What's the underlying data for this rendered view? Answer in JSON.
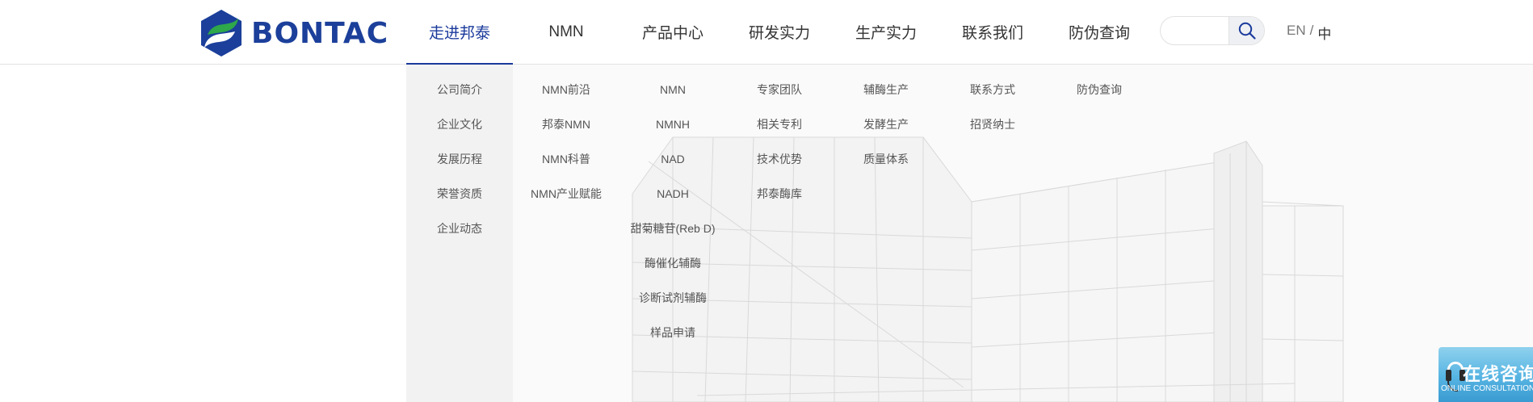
{
  "brand": {
    "name": "BONTAC"
  },
  "nav": [
    {
      "label": "走进邦泰",
      "active": true
    },
    {
      "label": "NMN",
      "active": false
    },
    {
      "label": "产品中心",
      "active": false
    },
    {
      "label": "研发实力",
      "active": false
    },
    {
      "label": "生产实力",
      "active": false
    },
    {
      "label": "联系我们",
      "active": false
    },
    {
      "label": "防伪查询",
      "active": false
    }
  ],
  "search": {
    "placeholder": "",
    "value": ""
  },
  "lang": {
    "en": "EN",
    "sep": "/",
    "zh": "中"
  },
  "dropdown": {
    "columns": [
      [
        "公司简介",
        "企业文化",
        "发展历程",
        "荣誉资质",
        "企业动态"
      ],
      [
        "NMN前沿",
        "邦泰NMN",
        "NMN科普",
        "NMN产业赋能"
      ],
      [
        "NMN",
        "NMNH",
        "NAD",
        "NADH",
        "甜菊糖苷(Reb D)",
        "酶催化辅酶",
        "诊断试剂辅酶",
        "样品申请"
      ],
      [
        "专家团队",
        "相关专利",
        "技术优势",
        "邦泰酶库"
      ],
      [
        "辅酶生产",
        "发酵生产",
        "质量体系"
      ],
      [
        "联系方式",
        "招贤纳士"
      ],
      [
        "防伪查询"
      ]
    ]
  },
  "consult": {
    "title": "在线咨询",
    "subtitle": "ONLINE CONSULTATION"
  },
  "colors": {
    "accent": "#1a3a9c",
    "logo_green": "#2ea84a",
    "logo_blue": "#1b3f9a"
  }
}
